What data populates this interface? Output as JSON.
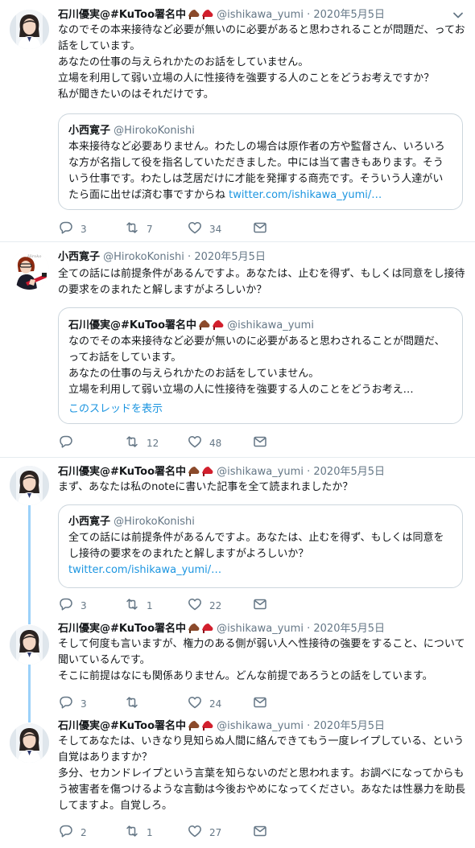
{
  "tweets": [
    {
      "name": "石川優実@#KuToo署名中",
      "handle": "@ishikawa_yumi",
      "sep": "·",
      "date": "2020年5月5日",
      "text": "なのでその本来接待など必要が無いのに必要があると思わされることが問題だ、ってお話をしています。\nあなたの仕事の与えられかたのお話をしていません。\n立場を利用して弱い立場の人に性接待を強要する人のことをどうお考えですか？\n私が聞きたいのはそれだけです。",
      "quote": {
        "name": "小西寛子",
        "handle": "@HirokoKonishi",
        "text": "本来接待など必要ありません。わたしの場合は原作者の方や監督さん、いろいろな方が名指して役を指名していただきました。中には当て書きもあります。そういう仕事です。わたしは芝居だけに才能を発揮する商売です。そういう人達がいたら面に出せば済む事ですからね ",
        "link": "twitter.com/ishikawa_yumi/…"
      },
      "replies": "3",
      "retweets": "7",
      "likes": "34"
    },
    {
      "name": "小西寛子",
      "handle": "@HirokoKonishi",
      "sep": "·",
      "date": "2020年5月5日",
      "text": "全ての話には前提条件があるんですよ。あなたは、止むを得ず、もしくは同意をし接待の要求をのまれたと解しますがよろしいか？",
      "quote": {
        "name": "石川優実@#KuToo署名中",
        "handle": "@ishikawa_yumi",
        "text": "なのでその本来接待など必要が無いのに必要があると思わされることが問題だ、ってお話をしています。\nあなたの仕事の与えられかたのお話をしていません。\n立場を利用して弱い立場の人に性接待を強要する人のことをどうお考え…",
        "thread_link": "このスレッドを表示"
      },
      "replies": "",
      "retweets": "12",
      "likes": "48"
    },
    {
      "name": "石川優実@#KuToo署名中",
      "handle": "@ishikawa_yumi",
      "sep": "·",
      "date": "2020年5月5日",
      "text": "まず、あなたは私のnoteに書いた記事を全て読まれましたか？",
      "quote": {
        "name": "小西寛子",
        "handle": "@HirokoKonishi",
        "text": "全ての話には前提条件があるんですよ。あなたは、止むを得ず、もしくは同意をし接待の要求をのまれたと解しますがよろしいか？\n",
        "link": "twitter.com/ishikawa_yumi/…"
      },
      "replies": "3",
      "retweets": "1",
      "likes": "22"
    },
    {
      "name": "石川優実@#KuToo署名中",
      "handle": "@ishikawa_yumi",
      "sep": "·",
      "date": "2020年5月5日",
      "text": "そして何度も言いますが、権力のある側が弱い人へ性接待の強要をすること、について聞いているんです。\nそこに前提はなにも関係ありません。どんな前提であろうとの話をしています。",
      "replies": "3",
      "retweets": "",
      "likes": "24"
    },
    {
      "name": "石川優実@#KuToo署名中",
      "handle": "@ishikawa_yumi",
      "sep": "·",
      "date": "2020年5月5日",
      "text": "そしてあなたは、いきなり見知らぬ人間に絡んできてもう一度レイプしている、という自覚はありますか？\n多分、セカンドレイプという言葉を知らないのだと思われます。お調べになってからもう被害者を傷つけるような言動は今後おやめになってください。あなたは性暴力を助長してますよ。自覚しろ。",
      "replies": "2",
      "retweets": "1",
      "likes": "27"
    }
  ],
  "colors": {
    "thread_line": "#9bd1f9",
    "muted": "#657786",
    "link": "#1b95e0",
    "border": "#ccd6dd"
  },
  "icons": [
    "reply-icon",
    "retweet-icon",
    "like-icon",
    "dm-icon",
    "chevron-down-icon",
    "shoe-emoji"
  ]
}
